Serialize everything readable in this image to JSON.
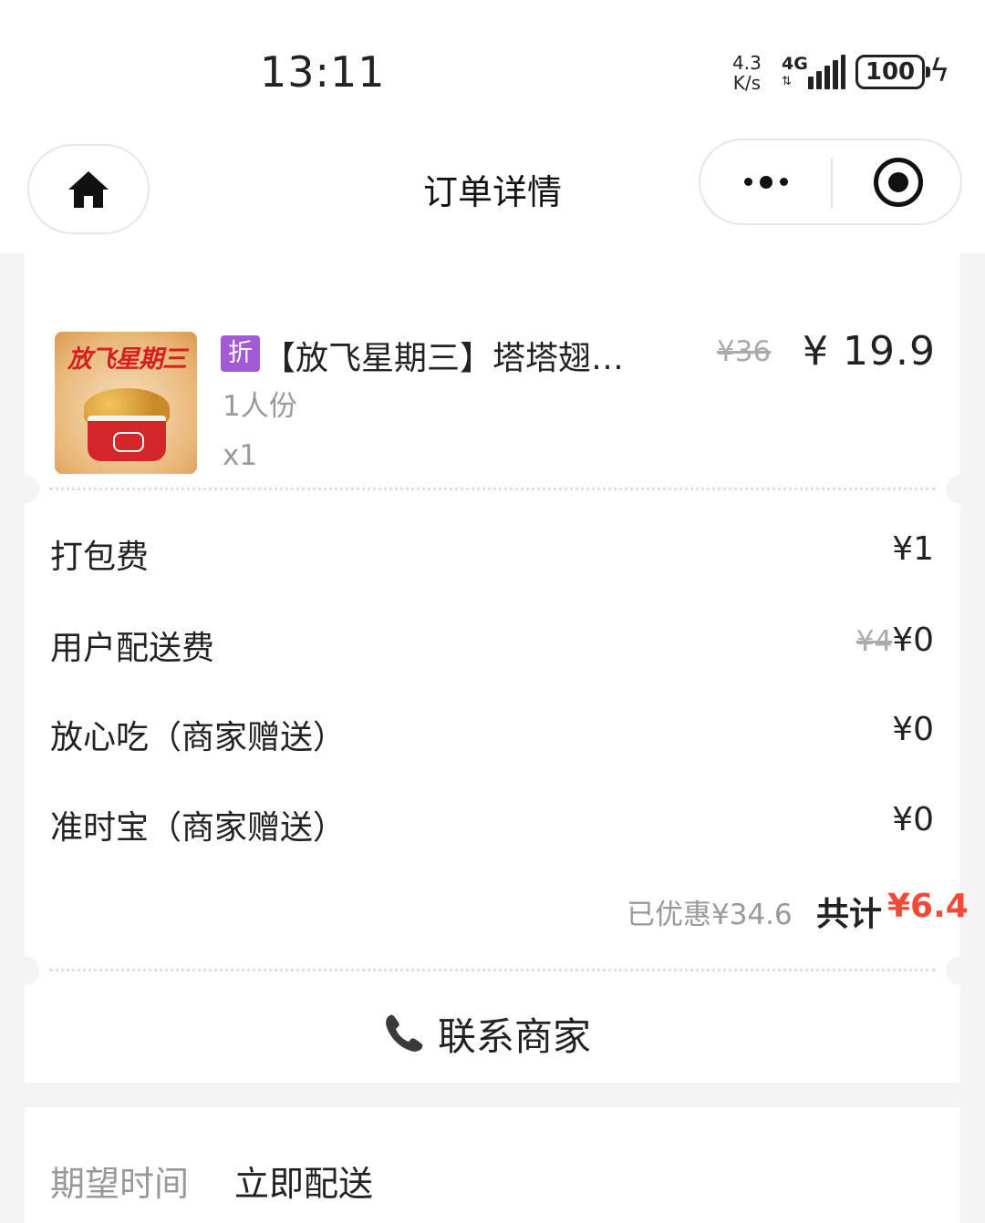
{
  "status_bar": {
    "time": "13:11",
    "net_speed_value": "4.3",
    "net_speed_unit": "K/s",
    "network": "4G",
    "battery": "100",
    "icons": [
      "signal-icon",
      "battery-icon",
      "charging-icon"
    ]
  },
  "header": {
    "title": "订单详情",
    "icons": [
      "home-icon",
      "more-icon",
      "target-icon"
    ]
  },
  "item": {
    "image_text": "放飞星期三",
    "discount_tag": "折",
    "name": "【放飞星期三】塔塔翅…",
    "original_price": "¥36",
    "price": "¥ 19.9",
    "portion": "1人份",
    "quantity": "x1"
  },
  "fees": [
    {
      "label": "打包费",
      "value": "¥1",
      "original": ""
    },
    {
      "label": "用户配送费",
      "value": "¥0",
      "original": "¥4"
    },
    {
      "label": "放心吃（商家赠送）",
      "value": "¥0",
      "original": ""
    },
    {
      "label": "准时宝（商家赠送）",
      "value": "¥0",
      "original": ""
    }
  ],
  "summary": {
    "saved": "已优惠¥34.6",
    "total_label": "共计",
    "total_value": "¥6.4"
  },
  "contact": {
    "label": "联系商家",
    "icon": "phone-icon"
  },
  "delivery": {
    "label": "期望时间",
    "value": "立即配送"
  },
  "colors": {
    "accent_red": "#f24a38",
    "discount_tag_purple": "#a25ad6",
    "muted_text": "#999999",
    "background": "#f4f4f4"
  }
}
